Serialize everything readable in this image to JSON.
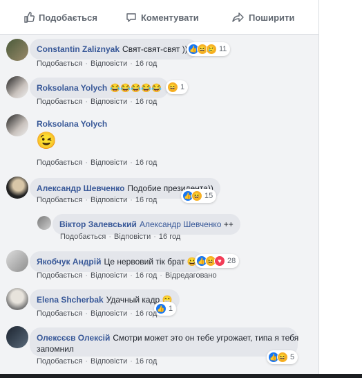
{
  "actions": {
    "like": "Подобається",
    "comment": "Коментувати",
    "share": "Поширити"
  },
  "labels": {
    "like": "Подобається",
    "reply": "Відповісти",
    "edited": "Відредаговано"
  },
  "comments": [
    {
      "author": "Constantin Zaliznyak",
      "text": "Свят-свят-свят )))",
      "time": "16 год",
      "reactions": "11"
    },
    {
      "author": "Roksolana Yolych",
      "text": "",
      "time": "16 год",
      "reactions": "1"
    },
    {
      "author": "Roksolana Yolych",
      "text": "",
      "time": "16 год"
    },
    {
      "author": "Александр Шевченко",
      "text": "Подобие президента))",
      "time": "16 год",
      "reactions": "15"
    },
    {
      "author": "Віктор Залевський",
      "mention": "Александр Шевченко",
      "text": "++",
      "time": "16 год"
    },
    {
      "author": "Якобчук Андрій",
      "text": "Це нервовий тік брат",
      "time": "16 год",
      "reactions": "28"
    },
    {
      "author": "Elena Shcherbak",
      "text": "Удачный кадр",
      "time": "16 год",
      "reactions": "1"
    },
    {
      "author": "Олексєєв Олексій",
      "text_line1": "Смотри может это он тебе угрожает, типа я тебя",
      "text_line2": "запомнил",
      "time": "16 год",
      "reactions": "5"
    }
  ],
  "colors": {
    "link": "#385898",
    "like": "#1877f2",
    "haha": "#f7b125",
    "love": "#f33e58"
  }
}
